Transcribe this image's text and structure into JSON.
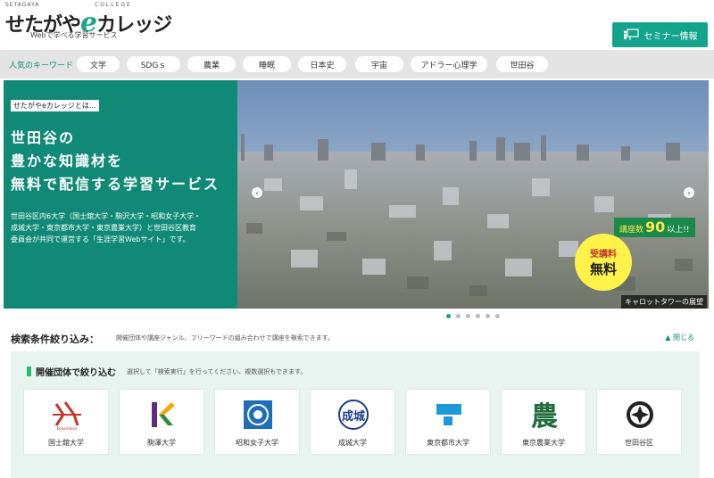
{
  "header": {
    "logo_top": "SETAGAYA",
    "logo_college": "COLLEGE",
    "logo_prefix": "せたがや",
    "logo_e": "e",
    "logo_suffix": "カレッジ",
    "tagline": "Webで学べる学習サービス",
    "seminar_button": "セミナー情報"
  },
  "keywords": {
    "label": "人気のキーワード",
    "items": [
      "文学",
      "SDGｓ",
      "農業",
      "睡眠",
      "日本史",
      "宇宙",
      "アドラー心理学",
      "世田谷"
    ]
  },
  "hero": {
    "kicker": "せたがやeカレッジとは...",
    "title_lines": [
      "世田谷の",
      "豊かな知識材を",
      "無料で配信する学習サービス"
    ],
    "desc_lines": [
      "世田谷区内6大学（国士舘大学・駒沢大学・昭和女子大学・",
      "成城大学・東京都市大学・東京農業大学）と世田谷区教育",
      "委員会が共同で運営する「生涯学習Webサイト」です。"
    ],
    "count_label": "講座数",
    "count_value": "90",
    "count_tail": "以上!!",
    "free_line1": "受講料",
    "free_line2": "無料",
    "caption": "キャロットタワーの展望",
    "prev_icon": "‹",
    "next_icon": "›",
    "slides_total": 6,
    "slide_active": 1
  },
  "search": {
    "title": "検索条件絞り込み：",
    "hint": "開催団体や講座ジャンル、フリーワードの組み合わせで講座を検索できます。",
    "close_label": "▲ 閉じる"
  },
  "filter": {
    "title": "開催団体で絞り込む",
    "hint": "選択して「検索実行」を行ってください、複数選択もできます。",
    "orgs": [
      {
        "name": "国士舘大学",
        "icon": "kokushikan-logo-icon",
        "logo_text": "Kokushikan"
      },
      {
        "name": "駒澤大学",
        "icon": "komazawa-logo-icon"
      },
      {
        "name": "昭和女子大学",
        "icon": "showa-logo-icon"
      },
      {
        "name": "成城大学",
        "icon": "seijo-logo-icon",
        "logo_text": "成城"
      },
      {
        "name": "東京都市大学",
        "icon": "tcu-logo-icon"
      },
      {
        "name": "東京農業大学",
        "icon": "nodai-logo-icon",
        "logo_text": "農"
      },
      {
        "name": "世田谷区",
        "icon": "setagaya-seal-icon"
      }
    ]
  },
  "colors": {
    "brand": "#14a38d",
    "hero_panel": "#108a77",
    "filter_bg": "#e8f4ef",
    "badge_yellow": "#fff34a"
  }
}
